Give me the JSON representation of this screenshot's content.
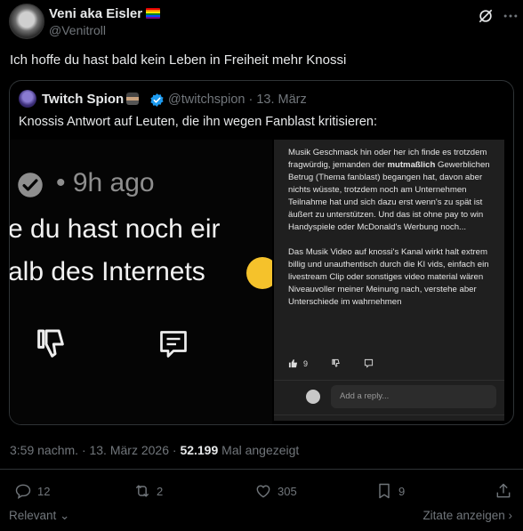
{
  "author": {
    "name": "Veni aka Eisler",
    "handle": "@Venitroll",
    "flag_icon": "rainbow-flag-icon"
  },
  "header_icons": [
    "grok-icon",
    "more-icon"
  ],
  "tweet": {
    "text": "Ich hoffe du hast bald kein Leben in Freiheit mehr Knossi"
  },
  "quote": {
    "name": "Twitch Spion",
    "spy_icon": "spy-emoji-icon",
    "verified_icon": "verified-badge-icon",
    "handle_date": "@twitchspion · 13. März",
    "text": "Knossis Antwort auf Leuten, die ihn wegen Fanblast kritisieren:",
    "image": {
      "left": {
        "ago": "• 9h ago",
        "line1": "e du hast noch eir",
        "line2": "alb des Internets"
      },
      "right": {
        "para1_a": "Musik Geschmack hin oder her ich finde es trotzdem fragwürdig, jemanden der ",
        "para1_bold": "mutmaßlich",
        "para1_b": " Gewerblichen Betrug (Thema fanblast) begangen hat, davon aber nichts wüsste, trotzdem noch am Unternehmen Teilnahme hat und sich dazu erst wenn's zu spät ist äußert zu unterstützen. Und das ist ohne pay to win Handyspiele oder McDonald's Werbung noch...",
        "para2": "Das Musik Video auf knossi's Kanal wirkt halt extrem billig und unauthentisch durch die KI vids, einfach ein livestream Clip oder sonstiges video material wären Niveauvoller meiner Meinung nach, verstehe aber Unterschiede im wahrnehmen",
        "like_count": "9",
        "reply_placeholder": "Add a reply..."
      }
    }
  },
  "meta": {
    "time": "3:59 nachm. · 13. März 2026 · ",
    "views": "52.199",
    "views_label": " Mal angezeigt"
  },
  "actions": {
    "replies": "12",
    "reposts": "2",
    "likes": "305",
    "bookmarks": "9"
  },
  "footer": {
    "sort": "Relevant",
    "quotes_link": "Zitate anzeigen"
  },
  "colors": {
    "background": "#000000",
    "text": "#e7e9ea",
    "secondary": "#71767b",
    "border": "#2f3336",
    "verified": "#1d9bf0"
  }
}
